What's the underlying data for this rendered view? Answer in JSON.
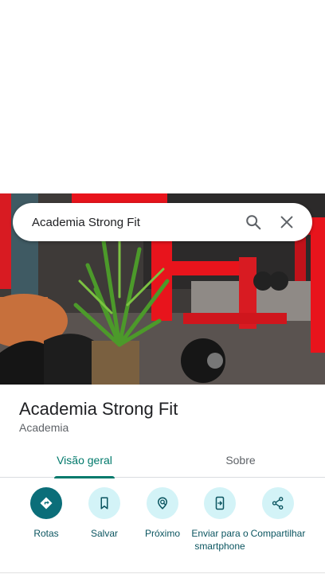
{
  "search": {
    "query": "Academia Strong Fit"
  },
  "place": {
    "name": "Academia Strong Fit",
    "category": "Academia"
  },
  "tabs": [
    {
      "label": "Visão geral",
      "active": true
    },
    {
      "label": "Sobre",
      "active": false
    }
  ],
  "actions": [
    {
      "label": "Rotas",
      "icon": "directions-icon"
    },
    {
      "label": "Salvar",
      "icon": "bookmark-icon"
    },
    {
      "label": "Próximo",
      "icon": "nearby-icon"
    },
    {
      "label": "Enviar para o smartphone",
      "icon": "send-to-phone-icon"
    },
    {
      "label": "Compartilhar",
      "icon": "share-icon"
    }
  ],
  "colors": {
    "accent": "#0b6e79",
    "action_bg": "#d3f3f7",
    "tab_active": "#00796b",
    "equipment_red": "#e8141c"
  }
}
